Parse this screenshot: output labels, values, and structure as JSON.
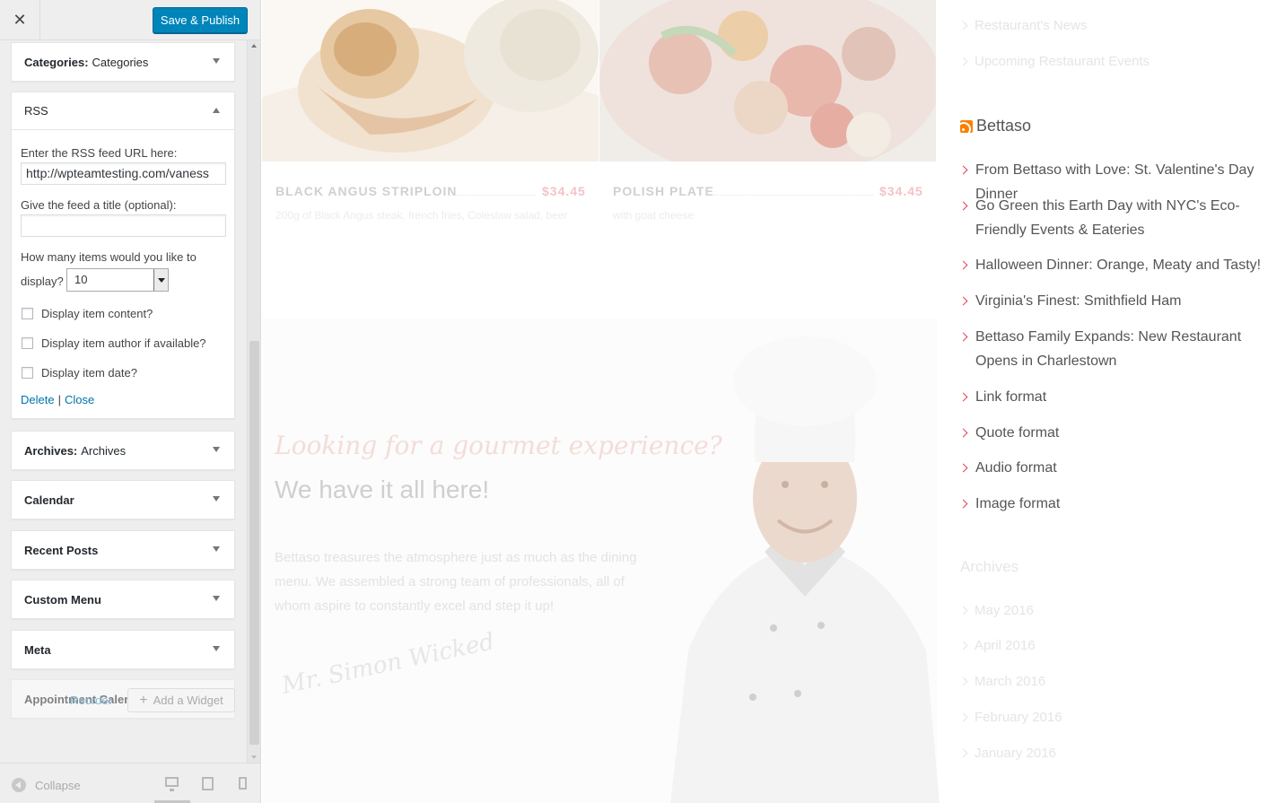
{
  "header": {
    "close_glyph": "✕",
    "publish_label": "Save & Publish"
  },
  "widgets": {
    "categories": {
      "title": "Categories:",
      "subtitle": "Categories"
    },
    "rss": {
      "title": "RSS",
      "url_label": "Enter the RSS feed URL here:",
      "url_value": "http://wpteamtesting.com/vaness",
      "title_label": "Give the feed a title (optional):",
      "title_value": "",
      "items_label_1": "How many items would you like to",
      "items_label_2": "display?",
      "items_value": "10",
      "opt_content": "Display item content?",
      "opt_author": "Display item author if available?",
      "opt_date": "Display item date?",
      "delete_label": "Delete",
      "sep": "|",
      "close_label": "Close"
    },
    "archives": {
      "title": "Archives:",
      "subtitle": "Archives"
    },
    "calendar": {
      "title": "Calendar"
    },
    "recent_posts": {
      "title": "Recent Posts"
    },
    "custom_menu": {
      "title": "Custom Menu"
    },
    "meta": {
      "title": "Meta"
    },
    "appointment": {
      "title": "Appointment Calendar"
    }
  },
  "actions": {
    "reorder_label": "Reorder",
    "add_widget_label": "Add a Widget"
  },
  "footer": {
    "collapse_label": "Collapse"
  },
  "preview": {
    "menu": [
      {
        "name": "BLACK ANGUS STRIPLOIN",
        "price": "$34.45",
        "desc": "200g of Black Angus steak, french fries, Coleslaw salad, beer"
      },
      {
        "name": "POLISH PLATE",
        "price": "$34.45",
        "desc": "with goat cheese"
      }
    ],
    "hero": {
      "script": "Looking for a gourmet experience?",
      "title": "We have it all here!",
      "text": "Bettaso  treasures the atmosphere just as much as the dining menu. We assembled a strong team of professionals, all of whom aspire to constantly excel and step it up!",
      "signature": "Mr. Simon Wicked"
    },
    "right": {
      "top_links": [
        "Restaurant's News",
        "Upcoming Restaurant Events"
      ],
      "rss_title": "Bettaso",
      "feed_items": [
        "From Bettaso with Love: St. Valentine's Day Dinner",
        "Go Green this Earth Day with NYC's Eco-Friendly Events & Eateries",
        "Halloween Dinner: Orange, Meaty and Tasty!",
        "Virginia's Finest: Smithfield Ham",
        "Bettaso Family Expands: New Restaurant Opens in Charlestown",
        "Link format",
        "Quote format",
        "Audio format",
        "Image format"
      ],
      "archives_title": "Archives",
      "archive_months": [
        "May 2016",
        "April 2016",
        "March 2016",
        "February 2016",
        "January 2016"
      ]
    }
  },
  "colors": {
    "primary_button": "#0085ba",
    "link": "#0073aa",
    "accent_red": "#e4414f",
    "rss_orange": "#f98100"
  }
}
